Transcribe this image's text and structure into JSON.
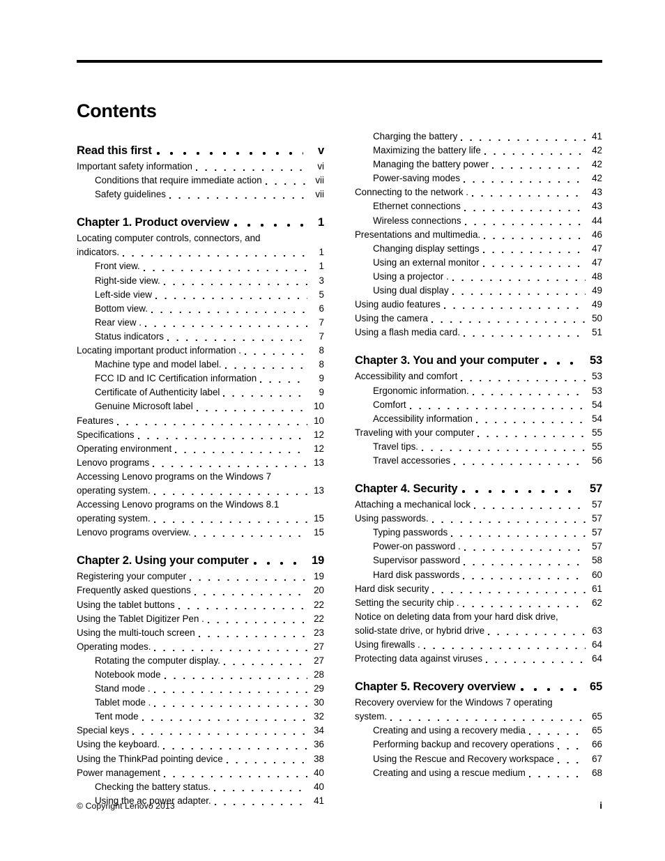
{
  "document": {
    "title": "Contents"
  },
  "footer": {
    "copyright": "© Copyright Lenovo 2013",
    "folio": "i"
  },
  "toc": {
    "left_column": [
      {
        "label": "Read this first",
        "page": "v",
        "level": 1,
        "chapter": true
      },
      {
        "label": "Important safety information",
        "page": "vi",
        "level": 1
      },
      {
        "label": "Conditions that require immediate action",
        "page": "vii",
        "level": 2
      },
      {
        "label": "Safety guidelines",
        "page": "vii",
        "level": 2
      },
      {
        "label": "Chapter 1. Product overview",
        "page": "1",
        "level": 1,
        "chapter": true
      },
      {
        "label": "Locating computer controls, connectors, and",
        "label2": "indicators.",
        "page": "1",
        "level": 1,
        "wrap": true
      },
      {
        "label": "Front view.",
        "page": "1",
        "level": 2
      },
      {
        "label": "Right-side view.",
        "page": "3",
        "level": 2
      },
      {
        "label": "Left-side view",
        "page": "5",
        "level": 2
      },
      {
        "label": "Bottom view.",
        "page": "6",
        "level": 2
      },
      {
        "label": "Rear view .",
        "page": "7",
        "level": 2
      },
      {
        "label": "Status indicators",
        "page": "7",
        "level": 2
      },
      {
        "label": "Locating important product information .",
        "page": "8",
        "level": 1
      },
      {
        "label": "Machine type and model label.",
        "page": "8",
        "level": 2
      },
      {
        "label": "FCC ID and IC Certification information",
        "page": "9",
        "level": 2
      },
      {
        "label": "Certificate of Authenticity label",
        "page": "9",
        "level": 2
      },
      {
        "label": "Genuine Microsoft label",
        "page": "10",
        "level": 2
      },
      {
        "label": "Features",
        "page": "10",
        "level": 1
      },
      {
        "label": "Specifications",
        "page": "12",
        "level": 1
      },
      {
        "label": "Operating environment",
        "page": "12",
        "level": 1
      },
      {
        "label": "Lenovo programs",
        "page": "13",
        "level": 1
      },
      {
        "label": "Accessing Lenovo programs on the Windows 7",
        "label2": "operating system.",
        "page": "13",
        "level": 1,
        "wrap": true
      },
      {
        "label": "Accessing Lenovo programs on the Windows 8.1",
        "label2": "operating system.",
        "page": "15",
        "level": 1,
        "wrap": true
      },
      {
        "label": "Lenovo programs overview.",
        "page": "15",
        "level": 1
      },
      {
        "label": "Chapter 2. Using your computer",
        "page": "19",
        "level": 1,
        "chapter": true
      },
      {
        "label": "Registering your computer",
        "page": "19",
        "level": 1
      },
      {
        "label": "Frequently asked questions",
        "page": "20",
        "level": 1
      },
      {
        "label": "Using the tablet buttons",
        "page": "22",
        "level": 1
      },
      {
        "label": "Using the Tablet Digitizer Pen .",
        "page": "22",
        "level": 1
      },
      {
        "label": "Using the multi-touch screen",
        "page": "23",
        "level": 1
      },
      {
        "label": "Operating modes.",
        "page": "27",
        "level": 1
      },
      {
        "label": "Rotating the computer display.",
        "page": "27",
        "level": 2
      },
      {
        "label": "Notebook mode",
        "page": "28",
        "level": 2
      },
      {
        "label": "Stand mode .",
        "page": "29",
        "level": 2
      },
      {
        "label": "Tablet mode .",
        "page": "30",
        "level": 2
      },
      {
        "label": "Tent mode",
        "page": "32",
        "level": 2
      },
      {
        "label": "Special keys",
        "page": "34",
        "level": 1
      },
      {
        "label": "Using the keyboard.",
        "page": "36",
        "level": 1
      },
      {
        "label": "Using the ThinkPad pointing device",
        "page": "38",
        "level": 1
      },
      {
        "label": "Power management",
        "page": "40",
        "level": 1
      },
      {
        "label": "Checking the battery status.",
        "page": "40",
        "level": 2
      },
      {
        "label": "Using the ac power adapter.",
        "page": "41",
        "level": 2
      }
    ],
    "right_column": [
      {
        "label": "Charging the battery",
        "page": "41",
        "level": 2
      },
      {
        "label": "Maximizing the battery life",
        "page": "42",
        "level": 2
      },
      {
        "label": "Managing the battery power",
        "page": "42",
        "level": 2
      },
      {
        "label": "Power-saving modes",
        "page": "42",
        "level": 2
      },
      {
        "label": "Connecting to the network .",
        "page": "43",
        "level": 1
      },
      {
        "label": "Ethernet connections",
        "page": "43",
        "level": 2
      },
      {
        "label": "Wireless connections",
        "page": "44",
        "level": 2
      },
      {
        "label": "Presentations and multimedia.",
        "page": "46",
        "level": 1
      },
      {
        "label": "Changing display settings",
        "page": "47",
        "level": 2
      },
      {
        "label": "Using an external monitor",
        "page": "47",
        "level": 2
      },
      {
        "label": "Using a projector .",
        "page": "48",
        "level": 2
      },
      {
        "label": "Using dual display",
        "page": "49",
        "level": 2
      },
      {
        "label": "Using audio features",
        "page": "49",
        "level": 1
      },
      {
        "label": "Using the camera",
        "page": "50",
        "level": 1
      },
      {
        "label": "Using a flash media card.",
        "page": "51",
        "level": 1
      },
      {
        "label": "Chapter 3. You and your computer",
        "page": "53",
        "level": 1,
        "chapter": true
      },
      {
        "label": "Accessibility and comfort",
        "page": "53",
        "level": 1
      },
      {
        "label": "Ergonomic information.",
        "page": "53",
        "level": 2
      },
      {
        "label": "Comfort",
        "page": "54",
        "level": 2
      },
      {
        "label": "Accessibility information",
        "page": "54",
        "level": 2
      },
      {
        "label": "Traveling with your computer",
        "page": "55",
        "level": 1
      },
      {
        "label": "Travel tips.",
        "page": "55",
        "level": 2
      },
      {
        "label": "Travel accessories",
        "page": "56",
        "level": 2
      },
      {
        "label": "Chapter 4. Security",
        "page": "57",
        "level": 1,
        "chapter": true
      },
      {
        "label": "Attaching a mechanical lock",
        "page": "57",
        "level": 1
      },
      {
        "label": "Using passwords.",
        "page": "57",
        "level": 1
      },
      {
        "label": "Typing passwords",
        "page": "57",
        "level": 2
      },
      {
        "label": "Power-on password .",
        "page": "57",
        "level": 2
      },
      {
        "label": "Supervisor password",
        "page": "58",
        "level": 2
      },
      {
        "label": "Hard disk passwords",
        "page": "60",
        "level": 2
      },
      {
        "label": "Hard disk security",
        "page": "61",
        "level": 1
      },
      {
        "label": "Setting the security chip .",
        "page": "62",
        "level": 1
      },
      {
        "label": "Notice on deleting data from your hard disk drive,",
        "label2": "solid-state drive, or hybrid drive",
        "page": "63",
        "level": 1,
        "wrap": true
      },
      {
        "label": "Using firewalls .",
        "page": "64",
        "level": 1
      },
      {
        "label": "Protecting data against viruses",
        "page": "64",
        "level": 1
      },
      {
        "label": "Chapter 5. Recovery overview",
        "page": "65",
        "level": 1,
        "chapter": true
      },
      {
        "label": "Recovery overview for the Windows 7 operating",
        "label2": "system.",
        "page": "65",
        "level": 1,
        "wrap": true
      },
      {
        "label": "Creating and using a recovery media",
        "page": "65",
        "level": 2
      },
      {
        "label": "Performing backup and recovery operations",
        "page": "66",
        "level": 2
      },
      {
        "label": "Using the Rescue and Recovery workspace",
        "page": "67",
        "level": 2
      },
      {
        "label": "Creating and using a rescue medium",
        "page": "68",
        "level": 2
      }
    ]
  }
}
